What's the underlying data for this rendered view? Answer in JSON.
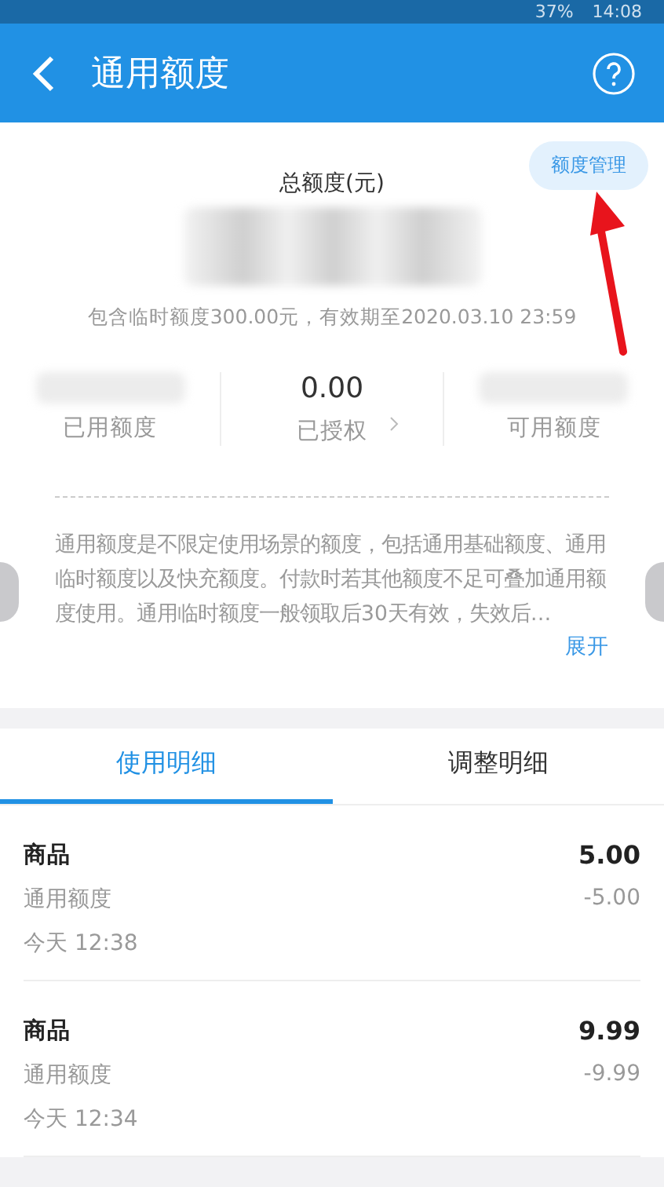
{
  "status_bar": {
    "battery": "37%",
    "time": "14:08"
  },
  "header": {
    "title": "通用额度"
  },
  "summary": {
    "manage_button": "额度管理",
    "total_label": "总额度(元)",
    "note": "包含临时额度300.00元，有效期至2020.03.10 23:59",
    "stats": [
      {
        "value_hidden": true,
        "label": "已用额度",
        "chevron": false
      },
      {
        "value": "0.00",
        "value_hidden": false,
        "label": "已授权",
        "chevron": true
      },
      {
        "value_hidden": true,
        "label": "可用额度",
        "chevron": false
      }
    ],
    "description": "通用额度是不限定使用场景的额度，包括通用基础额度、通用临时额度以及快充额度。付款时若其他额度不足可叠加通用额度使用。通用临时额度一般领取后30天有效，失效后…",
    "expand_link": "展开"
  },
  "tabs": [
    {
      "label": "使用明细",
      "selected": true
    },
    {
      "label": "调整明细",
      "selected": false
    }
  ],
  "records": [
    {
      "name": "商品",
      "amount": "5.00",
      "category": "通用额度",
      "change": "-5.00",
      "time": "今天 12:38"
    },
    {
      "name": "商品",
      "amount": "9.99",
      "category": "通用额度",
      "change": "-9.99",
      "time": "今天 12:34"
    }
  ]
}
